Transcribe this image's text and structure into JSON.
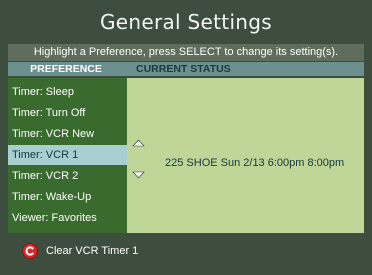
{
  "title": "General Settings",
  "instruction": "Highlight a Preference, press SELECT to change its setting(s).",
  "columns": {
    "preference": "PREFERENCE",
    "status": "CURRENT STATUS"
  },
  "preferences": [
    {
      "label": "Timer: Sleep"
    },
    {
      "label": "Timer: Turn Off"
    },
    {
      "label": "Timer: VCR New"
    },
    {
      "label": "Timer: VCR 1",
      "selected": true
    },
    {
      "label": "Timer: VCR 2"
    },
    {
      "label": "Timer: Wake-Up"
    },
    {
      "label": "Viewer: Favorites"
    }
  ],
  "current_status": "225   SHOE   Sun 2/13   6:00pm   8:00pm",
  "footer": {
    "icon": "c-button-icon",
    "label": "Clear VCR Timer 1"
  },
  "colors": {
    "background": "#3e4e3e",
    "preference_panel": "#3a6b2e",
    "status_panel": "#bfd698",
    "selection": "#a8cfd0",
    "header_bar": "#6c9090",
    "c_button": "#d8262a"
  }
}
